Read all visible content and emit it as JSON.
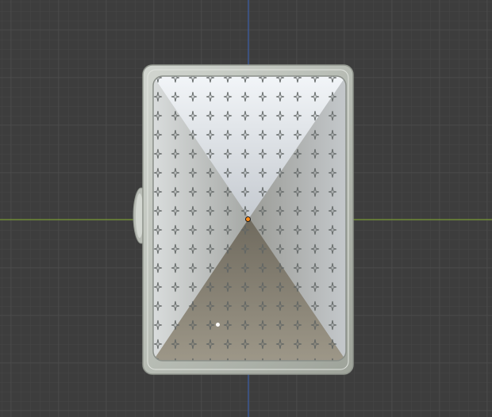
{
  "viewport": {
    "background_color": "#3d3d3d",
    "grid_minor_color": "#454545",
    "grid_major_color": "#4d4d4d",
    "x_axis_color": "#7a9a35",
    "y_axis_color": "#3d5fa8"
  },
  "object": {
    "frame_color": "#bfc3bc",
    "pattern_color": "#5a5f5e",
    "shading_light": "#e6ebef",
    "shading_dark": "#6e6a60",
    "origin_color": "#ff8c1a"
  }
}
